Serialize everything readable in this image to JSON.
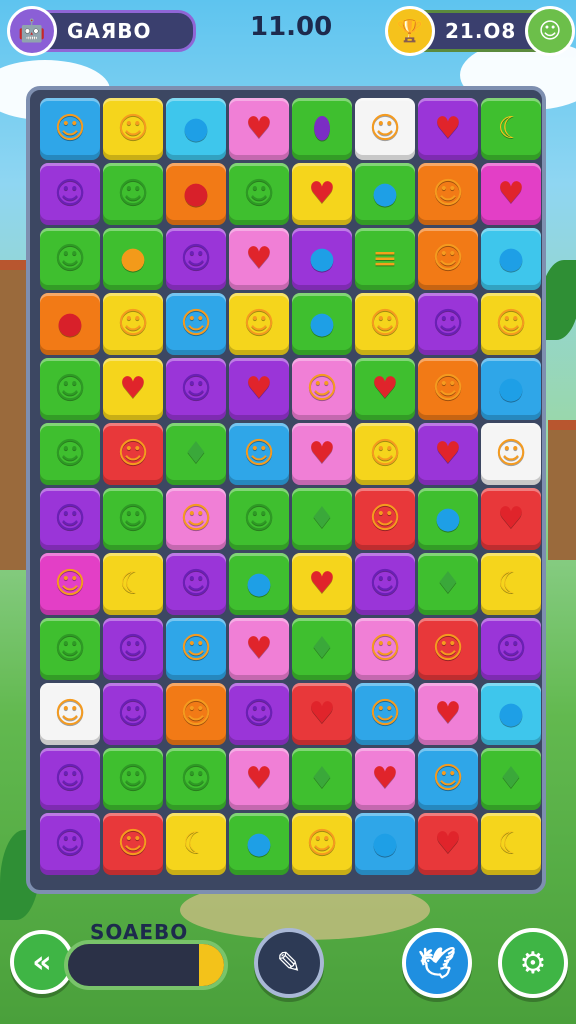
{
  "top_bar": {
    "player_label": "GAЯBO",
    "timer": "11.00",
    "coins": "21.O8"
  },
  "bottom_bar": {
    "score_label": "SOAEBO",
    "score_progress": 0.16
  },
  "board": {
    "rows": [
      [
        [
          "blue",
          "face"
        ],
        [
          "yellow",
          "face"
        ],
        [
          "cyan",
          "drop"
        ],
        [
          "pink",
          "heart"
        ],
        [
          "green",
          "eggplant"
        ],
        [
          "white",
          "face"
        ],
        [
          "purple",
          "heart"
        ],
        [
          "green",
          "banana"
        ]
      ],
      [
        [
          "purple",
          "face"
        ],
        [
          "green",
          "face"
        ],
        [
          "orange",
          "apple"
        ],
        [
          "green",
          "face"
        ],
        [
          "yellow",
          "heart"
        ],
        [
          "green",
          "drop"
        ],
        [
          "orange",
          "face"
        ],
        [
          "magenta",
          "heart"
        ]
      ],
      [
        [
          "green",
          "face"
        ],
        [
          "green",
          "mango"
        ],
        [
          "purple",
          "face"
        ],
        [
          "pink",
          "heart"
        ],
        [
          "purple",
          "drop"
        ],
        [
          "green",
          "burger"
        ],
        [
          "orange",
          "face"
        ],
        [
          "cyan",
          "drop"
        ]
      ],
      [
        [
          "orange",
          "apple"
        ],
        [
          "yellow",
          "face"
        ],
        [
          "blue",
          "face"
        ],
        [
          "yellow",
          "face"
        ],
        [
          "green",
          "drop"
        ],
        [
          "yellow",
          "face"
        ],
        [
          "purple",
          "face"
        ],
        [
          "yellow",
          "face"
        ]
      ],
      [
        [
          "green",
          "face"
        ],
        [
          "yellow",
          "heart"
        ],
        [
          "purple",
          "face"
        ],
        [
          "purple",
          "heart"
        ],
        [
          "pink",
          "face"
        ],
        [
          "green",
          "heart"
        ],
        [
          "orange",
          "face"
        ],
        [
          "blue",
          "drop"
        ]
      ],
      [
        [
          "green",
          "face"
        ],
        [
          "red",
          "face"
        ],
        [
          "green",
          "leaf"
        ],
        [
          "blue",
          "face"
        ],
        [
          "pink",
          "heart"
        ],
        [
          "yellow",
          "face"
        ],
        [
          "purple",
          "heart"
        ],
        [
          "white",
          "face"
        ]
      ],
      [
        [
          "purple",
          "face"
        ],
        [
          "green",
          "face"
        ],
        [
          "pink",
          "face"
        ],
        [
          "green",
          "face"
        ],
        [
          "green",
          "leaf"
        ],
        [
          "red",
          "face"
        ],
        [
          "green",
          "drop"
        ],
        [
          "red",
          "heart"
        ]
      ],
      [
        [
          "magenta",
          "face"
        ],
        [
          "yellow",
          "banana"
        ],
        [
          "purple",
          "face"
        ],
        [
          "green",
          "drop"
        ],
        [
          "yellow",
          "heart"
        ],
        [
          "purple",
          "face"
        ],
        [
          "green",
          "leaf"
        ],
        [
          "yellow",
          "banana"
        ]
      ],
      [
        [
          "green",
          "face"
        ],
        [
          "purple",
          "face"
        ],
        [
          "blue",
          "face"
        ],
        [
          "pink",
          "heart"
        ],
        [
          "green",
          "leaf"
        ],
        [
          "pink",
          "face"
        ],
        [
          "red",
          "face"
        ],
        [
          "purple",
          "face"
        ]
      ],
      [
        [
          "white",
          "face"
        ],
        [
          "purple",
          "face"
        ],
        [
          "orange",
          "face"
        ],
        [
          "purple",
          "face"
        ],
        [
          "red",
          "heart"
        ],
        [
          "blue",
          "face"
        ],
        [
          "pink",
          "heart"
        ],
        [
          "cyan",
          "drop"
        ]
      ],
      [
        [
          "purple",
          "face"
        ],
        [
          "green",
          "face"
        ],
        [
          "green",
          "face"
        ],
        [
          "pink",
          "heart"
        ],
        [
          "green",
          "leaf"
        ],
        [
          "pink",
          "heart"
        ],
        [
          "blue",
          "face"
        ],
        [
          "green",
          "leaf"
        ]
      ],
      [
        [
          "purple",
          "face"
        ],
        [
          "red",
          "face"
        ],
        [
          "yellow",
          "banana"
        ],
        [
          "green",
          "drop"
        ],
        [
          "yellow",
          "face"
        ],
        [
          "blue",
          "drop"
        ],
        [
          "red",
          "heart"
        ],
        [
          "yellow",
          "banana"
        ]
      ]
    ]
  },
  "colors": {
    "blue": "#2fa6e8",
    "yellow": "#f5d51c",
    "cyan": "#3ec6ec",
    "pink": "#f07fd6",
    "green": "#3fbf2f",
    "white": "#f5f5f5",
    "purple": "#9a35d8",
    "orange": "#f27a16",
    "magenta": "#e33fc6",
    "red": "#e8383a"
  },
  "icons": {
    "face": "☺",
    "heart": "♥",
    "drop": "●",
    "eggplant": "⬮",
    "banana": "☾",
    "apple": "●",
    "mango": "●",
    "burger": "≡",
    "leaf": "♦"
  },
  "icon_colors": {
    "face": "#f59b1f",
    "heart": "#e0242b",
    "drop": "#1e9fe6",
    "eggplant": "#7b2dc4",
    "banana": "#f8c61b",
    "apple": "#d8202a",
    "mango": "#f39a1a",
    "burger": "#f3a21b",
    "leaf": "#3aa83a"
  }
}
